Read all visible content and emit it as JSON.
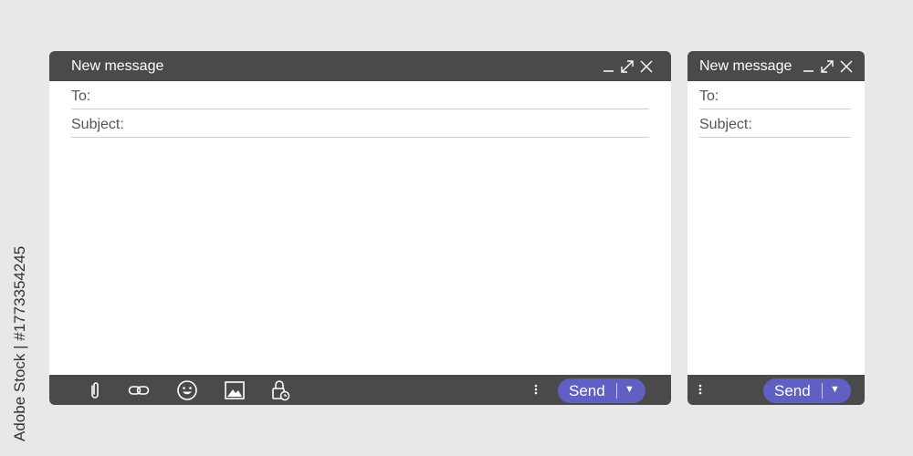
{
  "watermark": "Adobe Stock | #1773354245",
  "large_window": {
    "title": "New message",
    "to_label": "To:",
    "subject_label": "Subject:",
    "send_label": "Send",
    "send_arrow": "▼"
  },
  "small_window": {
    "title": "New message",
    "to_label": "To:",
    "subject_label": "Subject:",
    "send_label": "Send",
    "send_arrow": "▼"
  },
  "icons": [
    "minimize-icon",
    "maximize-icon",
    "close-icon",
    "paperclip-icon",
    "link-icon",
    "emoji-icon",
    "image-icon",
    "schedule-lock-icon",
    "more-options-icon",
    "dropdown-arrow-icon"
  ],
  "colors": {
    "background": "#e8e8e8",
    "bar": "#4a4a4a",
    "send_button": "#5f5fc4",
    "body": "#ffffff"
  }
}
